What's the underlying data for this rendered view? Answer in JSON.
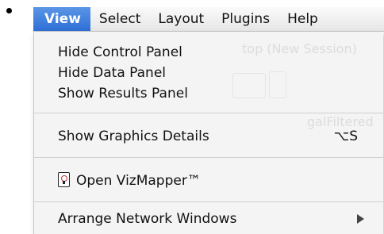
{
  "menubar": {
    "menus": [
      {
        "label": "View",
        "active": true
      },
      {
        "label": "Select",
        "active": false
      },
      {
        "label": "Layout",
        "active": false
      },
      {
        "label": "Plugins",
        "active": false
      },
      {
        "label": "Help",
        "active": false
      }
    ]
  },
  "background_window": {
    "title": "top (New Session)",
    "side_text": "galFiltered"
  },
  "view_menu": {
    "hide_control_panel": "Hide Control Panel",
    "hide_data_panel": "Hide Data Panel",
    "show_results_panel": "Show Results Panel",
    "show_graphics_details": "Show Graphics Details",
    "show_graphics_details_shortcut": "⌥S",
    "open_vizmapper": "Open VizMapper™",
    "open_vizmapper_icon": "vizmapper-icon",
    "arrange_network_windows": "Arrange Network Windows",
    "arrange_network_windows_submenu_icon": "submenu-arrow-icon"
  },
  "colors": {
    "menu_highlight": "#3b7ddd",
    "menu_background": "#f4f4f4",
    "separator": "#cfcfcf"
  }
}
